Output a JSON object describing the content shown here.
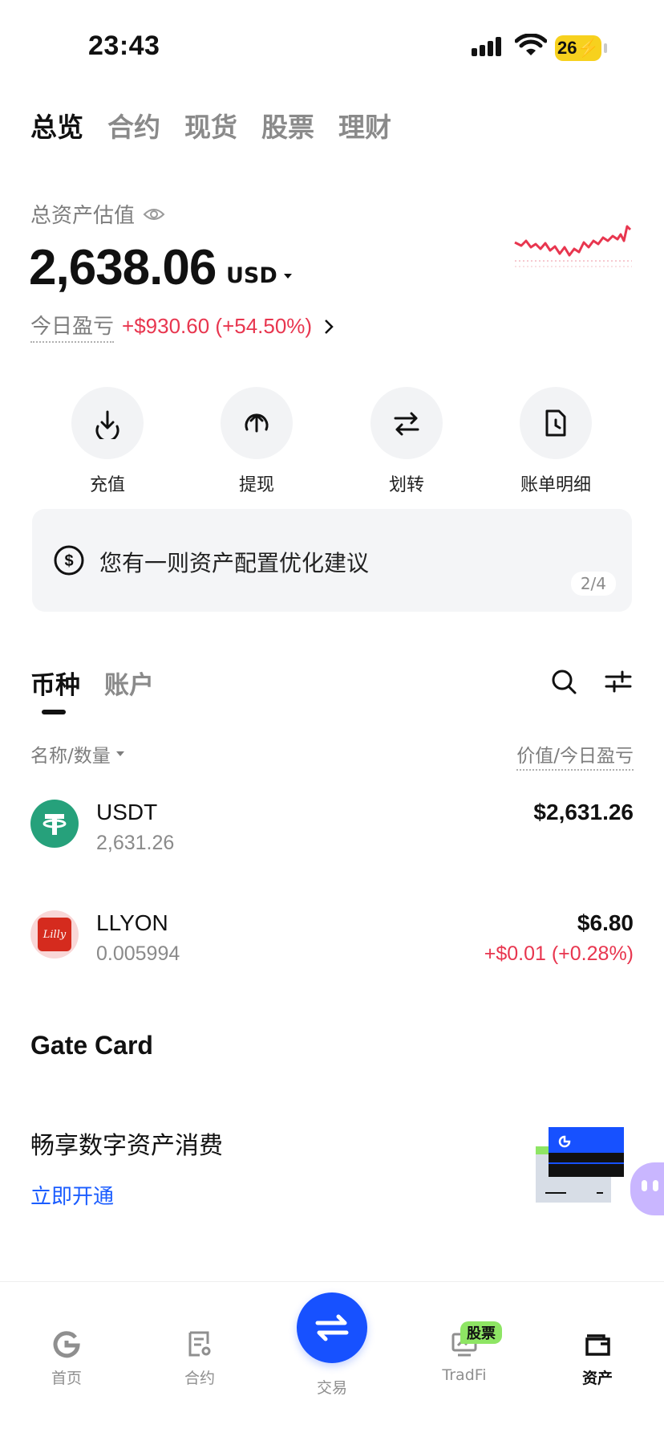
{
  "status_bar": {
    "time": "23:43",
    "battery": "26"
  },
  "top_tabs": [
    "总览",
    "合约",
    "现货",
    "股票",
    "理财"
  ],
  "assets": {
    "label": "总资产估值",
    "amount": "2,638.06",
    "currency": "USD",
    "pnl_label": "今日盈亏",
    "pnl_value": "+$930.60 (+54.50%)"
  },
  "actions": [
    {
      "label": "充值",
      "icon": "deposit-icon"
    },
    {
      "label": "提现",
      "icon": "withdraw-icon"
    },
    {
      "label": "划转",
      "icon": "transfer-icon"
    },
    {
      "label": "账单明细",
      "icon": "bill-icon"
    }
  ],
  "suggestion": {
    "text": "您有一则资产配置优化建议",
    "page": "2/4",
    "icon": "dollar-circle-icon"
  },
  "section_tabs": [
    "币种",
    "账户"
  ],
  "columns": {
    "left": "名称/数量",
    "right": "价值/今日盈亏"
  },
  "coins": [
    {
      "name": "USDT",
      "qty": "2,631.26",
      "value": "$2,631.26",
      "pnl": "",
      "icon": "tether-icon",
      "color": "#26a17b"
    },
    {
      "name": "LLYON",
      "qty": "0.005994",
      "value": "$6.80",
      "pnl": "+$0.01 (+0.28%)",
      "icon": "lilly-icon",
      "color": "#d52b1e",
      "icon_text": "Lilly"
    }
  ],
  "gate_card": {
    "title": "Gate Card",
    "subtitle": "畅享数字资产消费",
    "link": "立即开通"
  },
  "bottom_nav": [
    {
      "label": "首页",
      "icon": "home-icon"
    },
    {
      "label": "合约",
      "icon": "contract-icon"
    },
    {
      "label": "交易",
      "icon": "trade-icon"
    },
    {
      "label": "TradFi",
      "icon": "tradfi-icon",
      "badge": "股票"
    },
    {
      "label": "资产",
      "icon": "wallet-icon"
    }
  ],
  "colors": {
    "accent": "#1751ff",
    "loss_red": "#e8364f",
    "link_blue": "#1a5cff"
  }
}
